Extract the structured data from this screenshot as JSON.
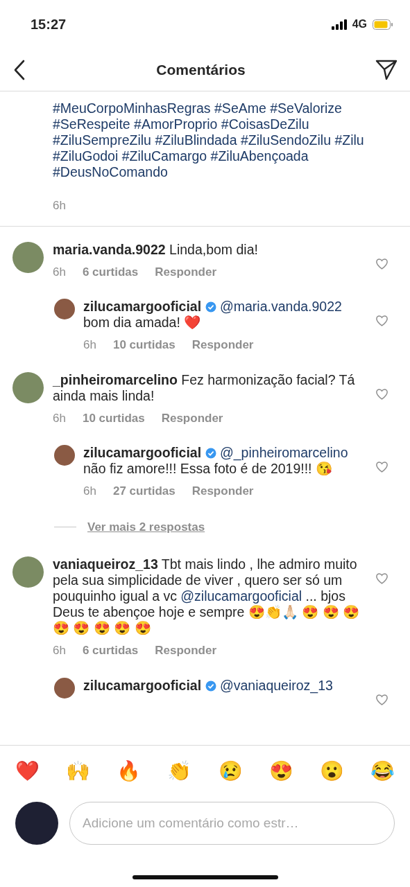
{
  "status_bar": {
    "time": "15:27",
    "network": "4G"
  },
  "header": {
    "title": "Comentários"
  },
  "caption": {
    "lines": [
      "#MeuCorpoMinhasRegras #SeAme #SeValorize",
      "#SeRespeite #AmorProprio #CoisasDeZilu",
      "#ZiluSempreZilu #ZiluBlindada #ZiluSendoZilu #Zilu",
      "#ZiluGodoi #ZiluCamargo #ZiluAbençoada",
      "#DeusNoComando"
    ],
    "time": "6h"
  },
  "comments": [
    {
      "kind": "comment",
      "username": "maria.vanda.9022",
      "verified": false,
      "body": [
        {
          "kind": "text",
          "text": "Linda,bom dia!"
        }
      ],
      "time": "6h",
      "likes": "6 curtidas",
      "reply": "Responder"
    },
    {
      "kind": "reply",
      "username": "zilucamargooficial",
      "verified": true,
      "body": [
        {
          "kind": "mention",
          "text": "@maria.vanda.9022"
        },
        {
          "kind": "text",
          "text": "bom dia amada! ❤️"
        }
      ],
      "time": "6h",
      "likes": "10 curtidas",
      "reply": "Responder"
    },
    {
      "kind": "comment",
      "username": "_pinheiromarcelino",
      "verified": false,
      "body": [
        {
          "kind": "text",
          "text": "Fez harmonização facial? Tá ainda mais linda!"
        }
      ],
      "time": "6h",
      "likes": "10 curtidas",
      "reply": "Responder"
    },
    {
      "kind": "reply",
      "username": "zilucamargooficial",
      "verified": true,
      "body": [
        {
          "kind": "mention",
          "text": "@_pinheiromarcelino"
        },
        {
          "kind": "text",
          "text": "não fiz amore!!! Essa foto é de 2019!!! 😘"
        }
      ],
      "time": "6h",
      "likes": "27 curtidas",
      "reply": "Responder"
    },
    {
      "kind": "view_more",
      "text": "Ver mais 2 respostas"
    },
    {
      "kind": "comment",
      "username": "vaniaqueiroz_13",
      "verified": false,
      "body": [
        {
          "kind": "text",
          "text": "Tbt mais lindo , lhe admiro muito pela sua simplicidade de viver , quero ser só um pouquinho igual a vc"
        },
        {
          "kind": "mention",
          "text": "@zilucamargooficial"
        },
        {
          "kind": "text",
          "text": "... bjos Deus te abençoe hoje e sempre 😍👏🙏🏻 😍 😍 😍 😍 😍 😍 😍 😍"
        }
      ],
      "time": "6h",
      "likes": "6 curtidas",
      "reply": "Responder"
    },
    {
      "kind": "reply",
      "username": "zilucamargooficial",
      "verified": true,
      "body": [
        {
          "kind": "mention",
          "text": "@vaniaqueiroz_13"
        }
      ]
    }
  ],
  "reactions": [
    "❤️",
    "🙌",
    "🔥",
    "👏",
    "😢",
    "😍",
    "😮",
    "😂"
  ],
  "composer": {
    "placeholder": "Adicione um comentário como estr…"
  }
}
